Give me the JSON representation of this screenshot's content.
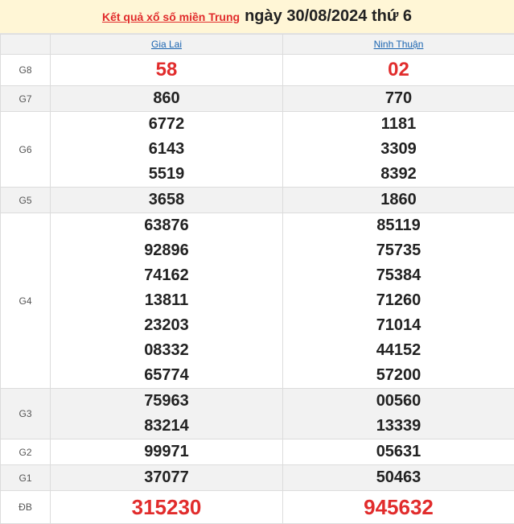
{
  "header": {
    "link_text": "Kết quả xổ số miền Trung",
    "date_text": "ngày 30/08/2024 thứ 6"
  },
  "provinces": [
    "Gia Lai",
    "Ninh Thuận"
  ],
  "prizes": [
    {
      "label": "G8",
      "values": [
        [
          "58"
        ],
        [
          "02"
        ]
      ]
    },
    {
      "label": "G7",
      "values": [
        [
          "860"
        ],
        [
          "770"
        ]
      ]
    },
    {
      "label": "G6",
      "values": [
        [
          "6772",
          "6143",
          "5519"
        ],
        [
          "1181",
          "3309",
          "8392"
        ]
      ]
    },
    {
      "label": "G5",
      "values": [
        [
          "3658"
        ],
        [
          "1860"
        ]
      ]
    },
    {
      "label": "G4",
      "values": [
        [
          "63876",
          "92896",
          "74162",
          "13811",
          "23203",
          "08332",
          "65774"
        ],
        [
          "85119",
          "75735",
          "75384",
          "71260",
          "71014",
          "44152",
          "57200"
        ]
      ]
    },
    {
      "label": "G3",
      "values": [
        [
          "75963",
          "83214"
        ],
        [
          "00560",
          "13339"
        ]
      ]
    },
    {
      "label": "G2",
      "values": [
        [
          "99971"
        ],
        [
          "05631"
        ]
      ]
    },
    {
      "label": "G1",
      "values": [
        [
          "37077"
        ],
        [
          "50463"
        ]
      ]
    },
    {
      "label": "ĐB",
      "values": [
        [
          "315230"
        ],
        [
          "945632"
        ]
      ]
    }
  ],
  "colors": {
    "accent": "#e12c2c",
    "link": "#1a64b0",
    "header_bg": "#fff6d6",
    "alt_row": "#f2f2f2"
  }
}
